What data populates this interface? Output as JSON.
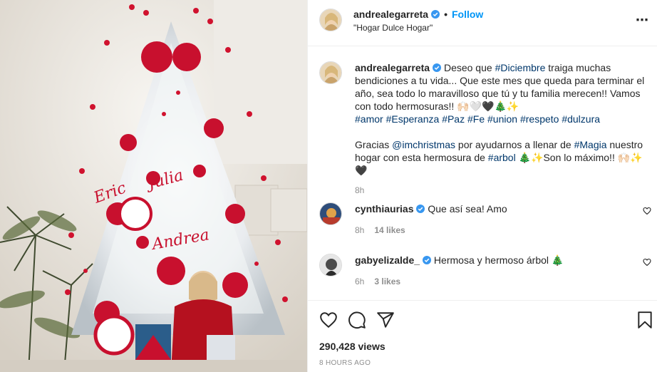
{
  "post": {
    "username": "andrealegarreta",
    "follow_label": "Follow",
    "dot": "•",
    "location": "\"Hogar Dulce Hogar\"",
    "more_icon": "⋯"
  },
  "caption": {
    "username": "andrealegarreta",
    "t1": " Deseo que ",
    "h1": "#Diciembre",
    "t2": " traiga muchas bendiciones a tu vida... Que este mes que queda para terminar el año, sea todo lo maravilloso que tú y tu familia merecen!! Vamos con todo hermosuras!! 🙌🏻🤍🖤🎄✨",
    "hashtags": [
      "#amor",
      "#Esperanza",
      "#Paz",
      "#Fe",
      "#union",
      "#respeto",
      "#dulzura"
    ],
    "p2_t1": "Gracias ",
    "p2_mention": "@imchristmas",
    "p2_t2": " por ayudarnos a llenar de ",
    "p2_h1": "#Magia",
    "p2_t3": " nuestro hogar con esta hermosura de ",
    "p2_h2": "#arbol",
    "p2_t4": " 🎄✨Son lo máximo!! 🙌🏻✨🖤",
    "time": "8h"
  },
  "comments": [
    {
      "username": "cynthiaurias",
      "text": " Que así sea! Amo",
      "time": "8h",
      "likes": "14 likes"
    },
    {
      "username": "gabyelizalde_",
      "text": " Hermosa y hermoso árbol 🎄",
      "time": "6h",
      "likes": "3 likes"
    }
  ],
  "footer": {
    "views": "290,428 views",
    "ago": "8 HOURS AGO"
  },
  "icons": [
    "verified-badge-icon",
    "more-options-icon",
    "heart-icon",
    "comment-icon",
    "share-icon",
    "bookmark-icon"
  ],
  "colors": {
    "link": "#0095f6",
    "hashtag": "#00376b",
    "muted": "#8e8e8e",
    "tree_red": "#c8102e"
  }
}
